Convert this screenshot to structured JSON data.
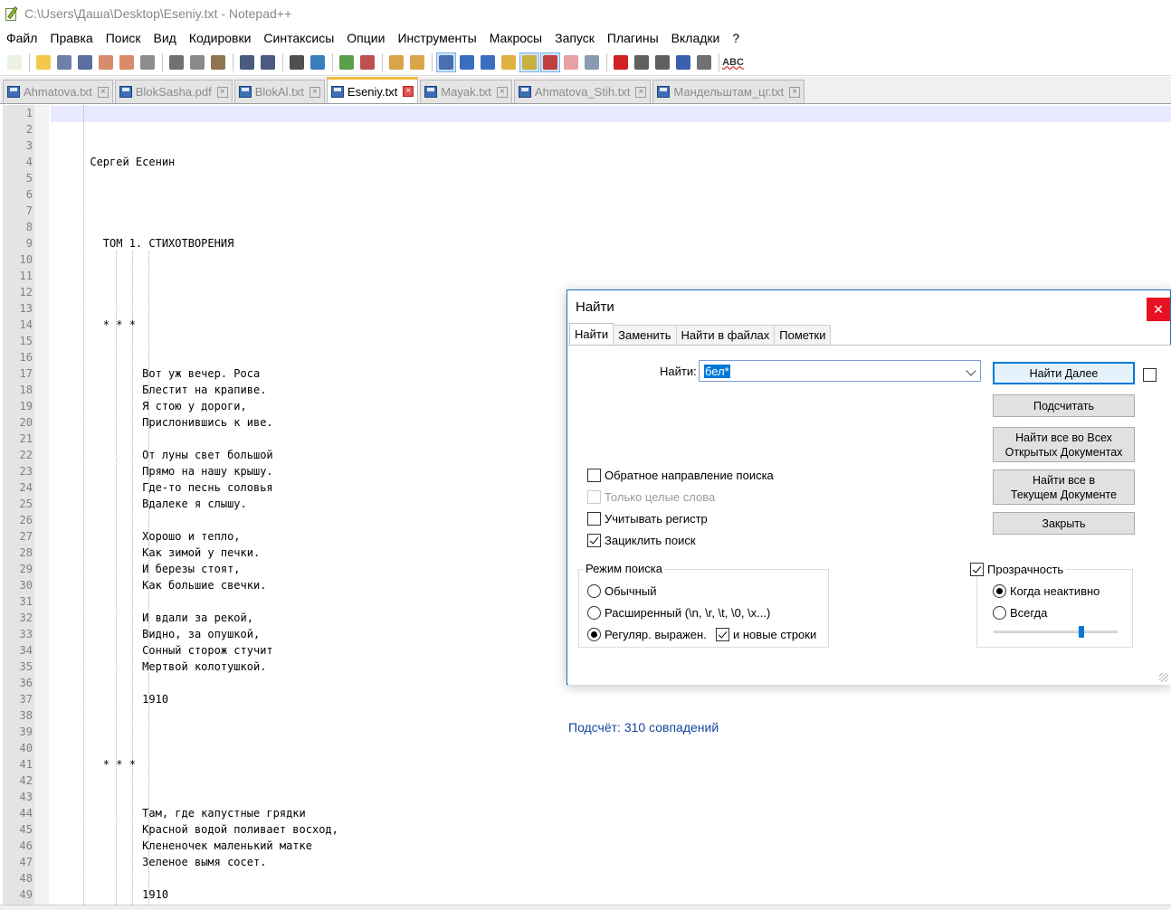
{
  "window": {
    "title": "C:\\Users\\Даша\\Desktop\\Eseniy.txt - Notepad++"
  },
  "menu": [
    "Файл",
    "Правка",
    "Поиск",
    "Вид",
    "Кодировки",
    "Синтаксисы",
    "Опции",
    "Инструменты",
    "Макросы",
    "Запуск",
    "Плагины",
    "Вкладки",
    "?"
  ],
  "toolbar": {
    "buttons": [
      {
        "icon": "new-file-icon",
        "color": "#e9f2e3"
      },
      {
        "icon": "open-folder-icon",
        "color": "#f2c94c"
      },
      {
        "icon": "save-icon",
        "color": "#6e7fa8"
      },
      {
        "icon": "save-all-icon",
        "color": "#5a6f9d"
      },
      {
        "icon": "close-file-icon",
        "color": "#d98b6b"
      },
      {
        "icon": "close-all-icon",
        "color": "#d98b6b"
      },
      {
        "icon": "print-icon",
        "color": "#8c8c8c"
      },
      {
        "icon": "cut-icon",
        "color": "#707070"
      },
      {
        "icon": "copy-icon",
        "color": "#8a8a8a"
      },
      {
        "icon": "paste-icon",
        "color": "#8e7450"
      },
      {
        "icon": "undo-icon",
        "color": "#4a5a80"
      },
      {
        "icon": "redo-icon",
        "color": "#4a5a80"
      },
      {
        "icon": "find-icon",
        "color": "#505050"
      },
      {
        "icon": "replace-icon",
        "color": "#3a7dbd"
      },
      {
        "icon": "zoom-in-icon",
        "color": "#5aa04a"
      },
      {
        "icon": "zoom-out-icon",
        "color": "#c05050"
      },
      {
        "icon": "sync-vertical-icon",
        "color": "#d8a54a"
      },
      {
        "icon": "sync-horizontal-icon",
        "color": "#d8a54a"
      },
      {
        "icon": "word-wrap-icon",
        "color": "#4a6fb0"
      },
      {
        "icon": "show-all-chars-icon",
        "color": "#3a6ec0"
      },
      {
        "icon": "indent-guide-icon",
        "color": "#3a6ec0"
      },
      {
        "icon": "folder-as-workspace-icon",
        "color": "#e0b040"
      },
      {
        "icon": "document-map-icon",
        "color": "#c8b040"
      },
      {
        "icon": "function-list-icon",
        "color": "#c04040"
      },
      {
        "icon": "folder-icon",
        "color": "#e8a0a0"
      },
      {
        "icon": "monitoring-icon",
        "color": "#8a9ab0"
      },
      {
        "icon": "record-macro-icon",
        "color": "#d02020"
      },
      {
        "icon": "stop-record-icon",
        "color": "#606060"
      },
      {
        "icon": "play-macro-icon",
        "color": "#606060"
      },
      {
        "icon": "run-macro-multiple-icon",
        "color": "#3a60b0"
      },
      {
        "icon": "save-macro-icon",
        "color": "#707070"
      },
      {
        "icon": "spell-check-icon",
        "color": "#333333"
      }
    ],
    "spell_label": "ABC"
  },
  "tabs": [
    {
      "label": "Ahmatova.txt",
      "active": false
    },
    {
      "label": "BlokSasha.pdf",
      "active": false
    },
    {
      "label": "BlokAl.txt",
      "active": false
    },
    {
      "label": "Eseniy.txt",
      "active": true
    },
    {
      "label": "Mayak.txt",
      "active": false
    },
    {
      "label": "Ahmatova_Stih.txt",
      "active": false
    },
    {
      "label": "Мандельштам_цг.txt",
      "active": false
    }
  ],
  "editor": {
    "line_numbers": [
      "1",
      "2",
      "3",
      "4",
      "5",
      "6",
      "7",
      "8",
      "9",
      "10",
      "11",
      "12",
      "13",
      "14",
      "15",
      "16",
      "17",
      "18",
      "19",
      "20",
      "21",
      "22",
      "23",
      "24",
      "25",
      "26",
      "27",
      "28",
      "29",
      "30",
      "31",
      "32",
      "33",
      "34",
      "35",
      "36",
      "37",
      "38",
      "39",
      "40",
      "41",
      "42",
      "43",
      "44",
      "45",
      "46",
      "47",
      "48",
      "49"
    ],
    "lines": [
      "",
      "",
      "",
      "      Сергей Есенин",
      "",
      "",
      "",
      "",
      "        ТОМ 1. СТИХОТВОРЕНИЯ",
      "",
      "",
      "",
      "",
      "        * * *",
      "",
      "",
      "              Вот уж вечер. Роса",
      "              Блестит на крапиве.",
      "              Я стою у дороги,",
      "              Прислонившись к иве.",
      "",
      "              От луны свет большой",
      "              Прямо на нашу крышу.",
      "              Где-то песнь соловья",
      "              Вдалеке я слышу.",
      "",
      "              Хорошо и тепло,",
      "              Как зимой у печки.",
      "              И березы стоят,",
      "              Как большие свечки.",
      "",
      "              И вдали за рекой,",
      "              Видно, за опушкой,",
      "              Сонный сторож стучит",
      "              Мертвой колотушкой.",
      "",
      "              1910",
      "",
      "",
      "",
      "        * * *",
      "",
      "",
      "              Там, где капустные грядки",
      "              Красной водой поливает восход,",
      "              Клененочек маленький матке",
      "              Зеленое вымя сосет.",
      "",
      "              1910"
    ]
  },
  "find_dialog": {
    "title": "Найти",
    "close_glyph": "✕",
    "tabs": [
      "Найти",
      "Заменить",
      "Найти в файлах",
      "Пометки"
    ],
    "find_label": "Найти:",
    "find_value": "бел*",
    "buttons": {
      "find_next": "Найти Далее",
      "count": "Подсчитать",
      "find_all_open_1": "Найти все во Всех",
      "find_all_open_2": "Открытых Документах",
      "find_all_current_1": "Найти все в",
      "find_all_current_2": "Текущем Документе",
      "close": "Закрыть"
    },
    "options": {
      "backward": {
        "label": "Обратное направление поиска",
        "checked": false
      },
      "whole_word": {
        "label": "Только целые слова",
        "checked": false,
        "disabled": true
      },
      "match_case": {
        "label": "Учитывать регистр",
        "checked": false
      },
      "wrap": {
        "label": "Зациклить поиск",
        "checked": true
      }
    },
    "search_mode": {
      "title": "Режим поиска",
      "normal": "Обычный",
      "extended": "Расширенный (\\n, \\r, \\t, \\0, \\x...)",
      "regex": "Регуляр. выражен.",
      "newline": "и новые строки",
      "selected": "regex",
      "newline_checked": true
    },
    "transparency": {
      "label": "Прозрачность",
      "checked": true,
      "on_inactive": "Когда неактивно",
      "always": "Всегда",
      "selected": "on_inactive",
      "level": 0.7
    },
    "status": "Подсчёт: 310 совпадений"
  }
}
